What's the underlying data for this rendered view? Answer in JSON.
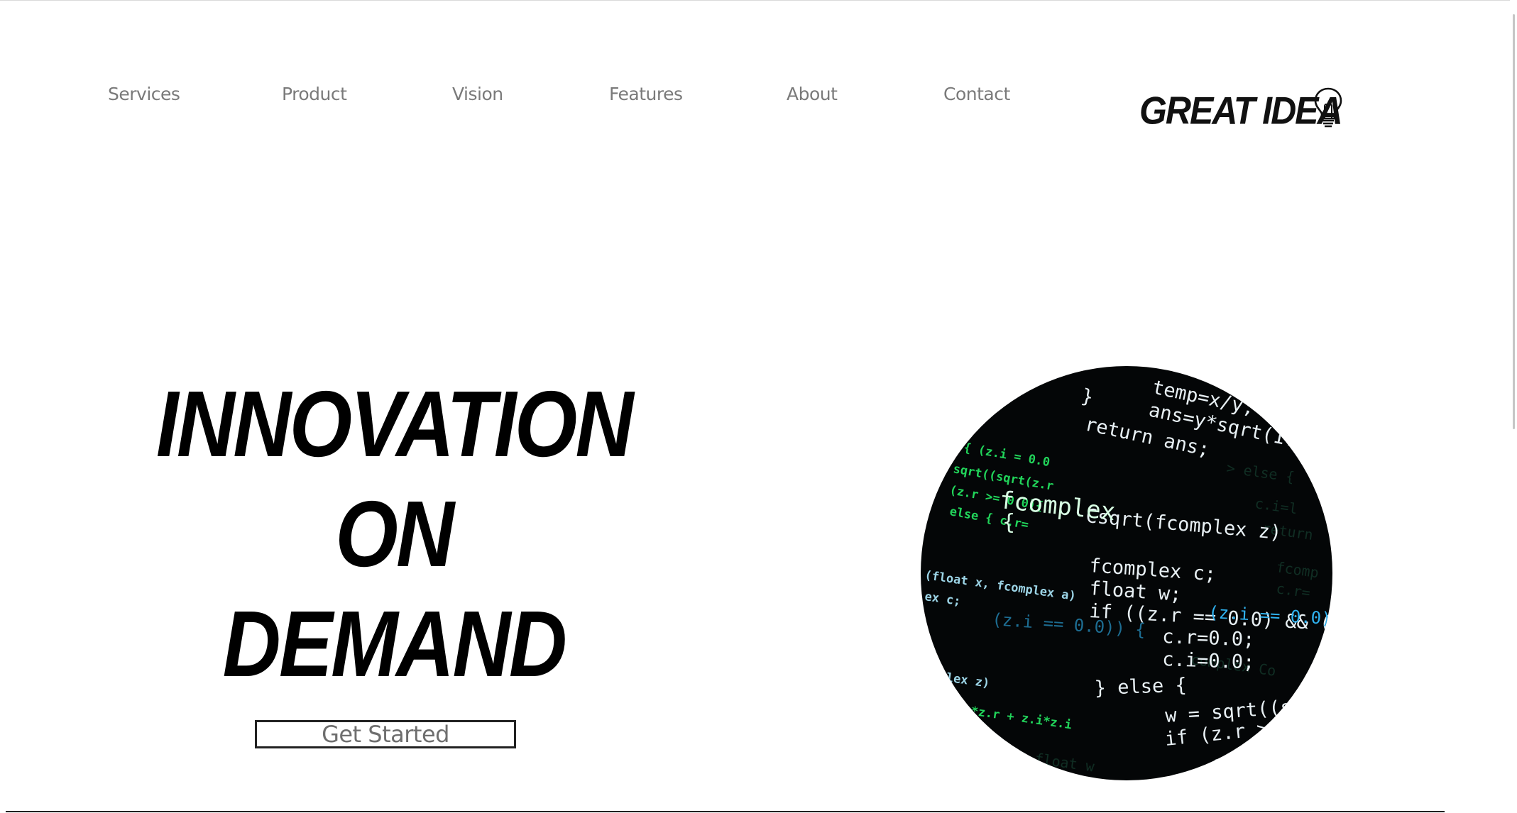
{
  "nav": {
    "items": [
      "Services",
      "Product",
      "Vision",
      "Features",
      "About",
      "Contact"
    ]
  },
  "logo": {
    "text": "GREAT IDEA",
    "icon": "lightbulb-icon"
  },
  "hero": {
    "title_lines": [
      "INNOVATION",
      "ON",
      "DEMAND"
    ],
    "cta_label": "Get Started",
    "image": "code-screen-image"
  },
  "colors": {
    "nav_text": "#7a7a7a",
    "title_text": "#000000",
    "code_bg": "#040607",
    "code_white": "#e8f0f4",
    "code_green": "#22e05a",
    "code_cyan": "#2fb2f0"
  }
}
